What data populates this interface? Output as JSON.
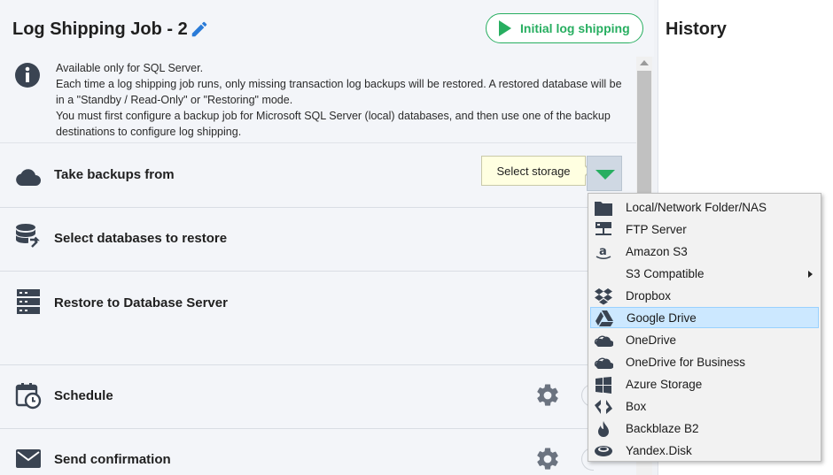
{
  "header": {
    "title": "Log Shipping Job - 2",
    "initial_button_label": "Initial log shipping"
  },
  "history": {
    "title": "History"
  },
  "info": {
    "lines": [
      "Available only for SQL Server.",
      "Each time a log shipping job runs, only missing transaction log backups will be restored. A restored database will be in a \"Standby / Read-Only\" or \"Restoring\" mode.",
      "You must first configure a backup job for Microsoft SQL Server (local) databases, and then use one of the backup destinations to configure log shipping."
    ]
  },
  "sections": {
    "backups": {
      "label": "Take backups from",
      "icon": "cloud-icon"
    },
    "databases": {
      "label": "Select databases to restore",
      "icon": "database-restore-icon"
    },
    "server": {
      "label": "Restore to Database Server",
      "icon": "server-icon"
    },
    "schedule": {
      "label": "Schedule",
      "icon": "calendar-clock-icon"
    },
    "confirmation": {
      "label": "Send confirmation",
      "icon": "envelope-icon"
    }
  },
  "tooltip": {
    "text": "Select storage"
  },
  "menu": {
    "items": [
      {
        "label": "Local/Network Folder/NAS",
        "icon": "folder-icon"
      },
      {
        "label": "FTP Server",
        "icon": "ftp-server-icon"
      },
      {
        "label": "Amazon S3",
        "icon": "amazon-icon"
      },
      {
        "label": "S3 Compatible",
        "icon": "none",
        "submenu": true
      },
      {
        "label": "Dropbox",
        "icon": "dropbox-icon"
      },
      {
        "label": "Google Drive",
        "icon": "google-drive-icon",
        "selected": true
      },
      {
        "label": "OneDrive",
        "icon": "onedrive-icon"
      },
      {
        "label": "OneDrive for Business",
        "icon": "onedrive-business-icon"
      },
      {
        "label": "Azure Storage",
        "icon": "windows-icon"
      },
      {
        "label": "Box",
        "icon": "box-icon"
      },
      {
        "label": "Backblaze B2",
        "icon": "backblaze-icon"
      },
      {
        "label": "Yandex.Disk",
        "icon": "yandex-disk-icon"
      }
    ]
  },
  "colors": {
    "accent": "#27ae60",
    "icon": "#3a4452",
    "selected_bg": "#cce8ff"
  }
}
